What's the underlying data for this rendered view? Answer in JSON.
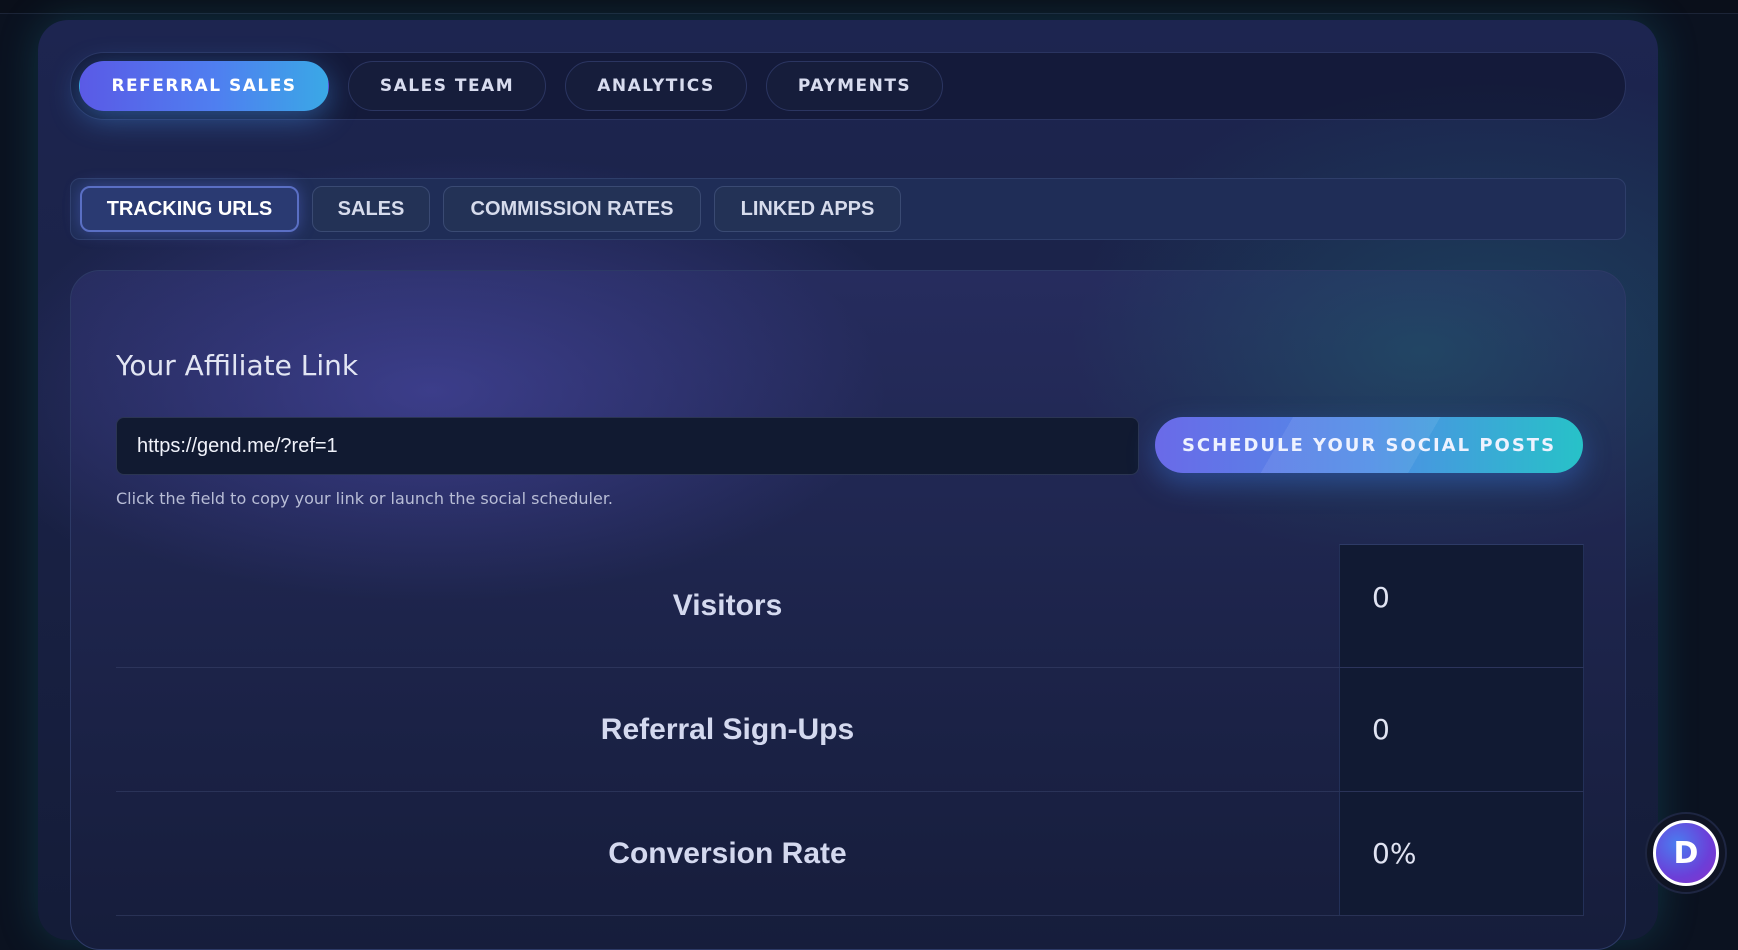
{
  "main_tabs": [
    {
      "label": "REFERRAL SALES",
      "active": true
    },
    {
      "label": "SALES TEAM",
      "active": false
    },
    {
      "label": "ANALYTICS",
      "active": false
    },
    {
      "label": "PAYMENTS",
      "active": false
    }
  ],
  "sub_tabs": [
    {
      "label": "TRACKING URLS",
      "active": true
    },
    {
      "label": "SALES",
      "active": false
    },
    {
      "label": "COMMISSION RATES",
      "active": false
    },
    {
      "label": "LINKED APPS",
      "active": false
    }
  ],
  "affiliate": {
    "title": "Your Affiliate Link",
    "link_value": "https://gend.me/?ref=1",
    "schedule_button": "SCHEDULE YOUR SOCIAL POSTS",
    "hint": "Click the field to copy your link or launch the social scheduler."
  },
  "stats": [
    {
      "label": "Visitors",
      "value": "0"
    },
    {
      "label": "Referral Sign-Ups",
      "value": "0"
    },
    {
      "label": "Conversion Rate",
      "value": "0%"
    }
  ],
  "floating_widget": {
    "letter": "D",
    "icon": "app-logo-icon"
  },
  "colors": {
    "active_tab_start": "#5a5ae6",
    "active_tab_end": "#3aa8e6",
    "button_start": "#6a6ae8",
    "button_end": "#27c2c8",
    "panel_bg": "#1d2550"
  }
}
